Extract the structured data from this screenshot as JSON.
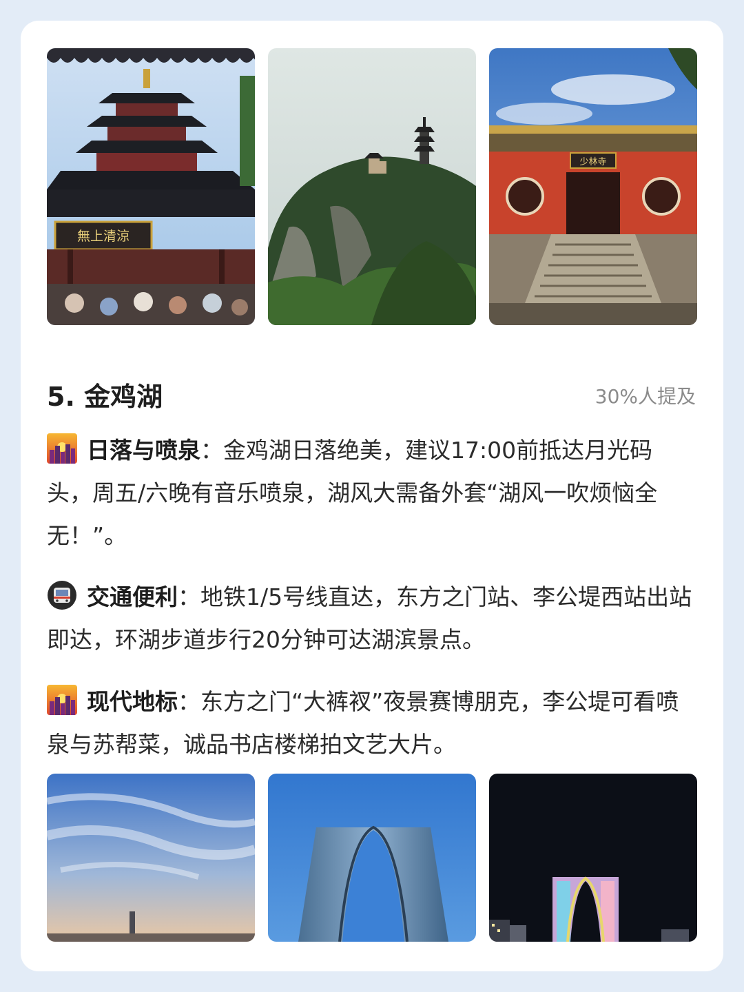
{
  "section": {
    "heading": "5. 金鸡湖",
    "mention": "30%人提及"
  },
  "items": [
    {
      "icon": "sunset-cityscape-icon",
      "title": "日落与喷泉",
      "colon": "：",
      "text": "金鸡湖日落绝美，建议17:00前抵达月光码头，周五/六晚有音乐喷泉，湖风大需备外套“湖风一吹烦恼全无！”。"
    },
    {
      "icon": "metro-train-icon",
      "title": "交通便利",
      "colon": "：",
      "text": "地铁1/5号线直达，东方之门站、李公堤西站出站即达，环湖步道步行20分钟可达湖滨景点。"
    },
    {
      "icon": "sunset-cityscape-icon",
      "title": "现代地标",
      "colon": "：",
      "text": "东方之门“大裤衩”夜景赛博朋克，李公堤可看喷泉与苏帮菜，诚品书店楼梯拍文艺大片。"
    }
  ],
  "photos_top": [
    {
      "sign": "無上清涼"
    },
    {
      "sign": ""
    },
    {
      "sign": "少林寺"
    }
  ],
  "colors": {
    "page_bg": "#e3ecf7",
    "card_bg": "#ffffff",
    "heading": "#1f1f1f",
    "muted": "#8b8b8b"
  }
}
